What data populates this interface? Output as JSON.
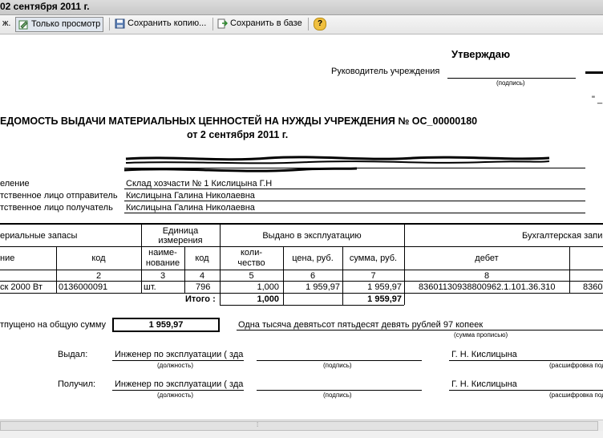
{
  "window": {
    "title": "02 сентября 2011 г."
  },
  "toolbar": {
    "cut_label": "ж.",
    "view_only_label": "Только просмотр",
    "save_copy_label": "Сохранить копию...",
    "save_db_label": "Сохранить в базе",
    "help_label": "?"
  },
  "header": {
    "approve": "Утверждаю",
    "head_label": "Руководитель учреждения",
    "signature_hint": "(подпись)",
    "date_mark": "\" _"
  },
  "doc": {
    "title": "ЕДОМОСТЬ ВЫДАЧИ МАТЕРИАЛЬНЫХ ЦЕННОСТЕЙ НА НУЖДЫ УЧРЕЖДЕНИЯ № ОС_00000180",
    "date": "от 2 сентября 2011 г.",
    "rows": [
      {
        "label": "еление",
        "value": "Склад хозчасти № 1 Кислицына Г.Н"
      },
      {
        "label": "тственное лицо отправитель",
        "value": "Кислицына Галина Николаевна"
      },
      {
        "label": "тственное лицо получатель",
        "value": "Кислицына Галина Николаевна"
      }
    ]
  },
  "table": {
    "h_materials": "ериальные запасы",
    "h_unit": "Единица измерения",
    "h_unit_l1": "Единица",
    "h_unit_l2": "измерения",
    "h_issued": "Выдано в эксплуатацию",
    "h_accounting": "Бухгалтерская запи",
    "h_name": "ние",
    "h_code": "код",
    "h_unit_name_l1": "наиме-",
    "h_unit_name_l2": "нование",
    "h_unit_code": "код",
    "h_qty_l1": "коли-",
    "h_qty_l2": "чество",
    "h_price": "цена, руб.",
    "h_sum": "сумма, руб.",
    "h_debit": "дебет",
    "nums": [
      "2",
      "3",
      "4",
      "5",
      "6",
      "7",
      "8"
    ],
    "row": {
      "name": "ск 2000 Вт",
      "code": "0136000091",
      "unit": "шт.",
      "unit_code": "796",
      "qty": "1,000",
      "price": "1 959,97",
      "sum": "1 959,97",
      "debit": "83601130938800962.1.101.36.310",
      "credit": "8360"
    },
    "total_label": "Итого :",
    "total_qty": "1,000",
    "total_sum": "1 959,97"
  },
  "footer": {
    "released_label": "тпущено на общую сумму",
    "total_box": "1 959,97",
    "total_words": "Одна тысяча девятьсот пятьдесят девять рублей 97 копеек",
    "words_hint": "(сумма прописью)",
    "issued_label": "Выдал:",
    "received_label": "Получил:",
    "position_value": "Инженер по эксплуатации ( зда",
    "position_hint": "(должность)",
    "signature_hint": "(подпись)",
    "person_value": "Г. Н. Кислицына",
    "decode_hint": "(расшифровка подпи"
  },
  "colors": {
    "toolbar_bg": "#eeeeee",
    "titlebar_bg": "#d4d4d4",
    "scribble": "#000000"
  }
}
